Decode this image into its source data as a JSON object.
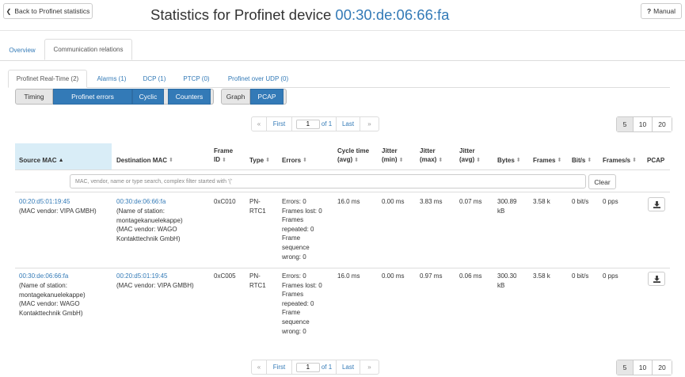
{
  "header": {
    "back_label": "Back to Profinet statistics",
    "back_icon": "chevron-left-icon",
    "title_prefix": "Statistics for Profinet device",
    "title_mac": "00:30:de:06:66:fa",
    "manual_label": "Manual",
    "manual_icon": "question-icon"
  },
  "tabs": [
    {
      "label": "Overview",
      "active": false
    },
    {
      "label": "Communication relations",
      "active": true
    }
  ],
  "subtabs": [
    {
      "label": "Profinet Real-Time (2)",
      "active": true
    },
    {
      "label": "Alarms (1)",
      "active": false
    },
    {
      "label": "DCP (1)",
      "active": false
    },
    {
      "label": "PTCP (0)",
      "active": false
    },
    {
      "label": "Profinet over UDP (0)",
      "active": false
    }
  ],
  "toggles": {
    "timing": "Timing",
    "profinet_errors": "Profinet errors",
    "cyclic": "Cyclic",
    "counters": "Counters",
    "graph": "Graph",
    "pcap": "PCAP"
  },
  "pagination": {
    "prev": "«",
    "first": "First",
    "page": "1",
    "of": "of 1",
    "last": "Last",
    "next": "»",
    "sizes": [
      "5",
      "10",
      "20"
    ],
    "active_size": "5"
  },
  "table": {
    "headers": {
      "source_mac": "Source MAC",
      "destination_mac": "Destination MAC",
      "frame_id_1": "Frame",
      "frame_id_2": "ID",
      "type": "Type",
      "errors": "Errors",
      "cycle_1": "Cycle time",
      "cycle_2": "(avg)",
      "jmin_1": "Jitter",
      "jmin_2": "(min)",
      "jmax_1": "Jitter",
      "jmax_2": "(max)",
      "javg_1": "Jitter",
      "javg_2": "(avg)",
      "bytes": "Bytes",
      "frames": "Frames",
      "bits": "Bit/s",
      "fps": "Frames/s",
      "pcap": "PCAP"
    },
    "sort_asc_glyph": "▲",
    "sort_glyph": "⬍",
    "filter_placeholder": "MAC, vendor, name or type search, complex filter started with '('",
    "clear_label": "Clear",
    "rows": [
      {
        "src_mac": "00:20:d5:01:19:45",
        "src_info": [
          "(MAC vendor: VIPA GMBH)"
        ],
        "dst_mac": "00:30:de:06:66:fa",
        "dst_info": [
          "(Name of station:",
          "montagekanuelekappe)",
          "(MAC vendor: WAGO",
          "Kontakttechnik GmbH)"
        ],
        "frame_id": "0xC010",
        "type": [
          "PN-",
          "RTC1"
        ],
        "errors": [
          "Errors: 0",
          "Frames lost: 0",
          "Frames",
          "repeated: 0",
          "Frame",
          "sequence",
          "wrong: 0"
        ],
        "cycle": "16.0 ms",
        "jmin": "0.00 ms",
        "jmax": "3.83 ms",
        "javg": "0.07 ms",
        "bytes": [
          "300.89",
          "kB"
        ],
        "frames": "3.58 k",
        "bits": "0 bit/s",
        "fps": "0 pps"
      },
      {
        "src_mac": "00:30:de:06:66:fa",
        "src_info": [
          "(Name of station:",
          "montagekanuelekappe)",
          "(MAC vendor: WAGO",
          "Kontakttechnik GmbH)"
        ],
        "dst_mac": "00:20:d5:01:19:45",
        "dst_info": [
          "(MAC vendor: VIPA GMBH)"
        ],
        "frame_id": "0xC005",
        "type": [
          "PN-",
          "RTC1"
        ],
        "errors": [
          "Errors: 0",
          "Frames lost: 0",
          "Frames",
          "repeated: 0",
          "Frame",
          "sequence",
          "wrong: 0"
        ],
        "cycle": "16.0 ms",
        "jmin": "0.00 ms",
        "jmax": "0.97 ms",
        "javg": "0.06 ms",
        "bytes": [
          "300.30",
          "kB"
        ],
        "frames": "3.58 k",
        "bits": "0 bit/s",
        "fps": "0 pps"
      }
    ]
  }
}
